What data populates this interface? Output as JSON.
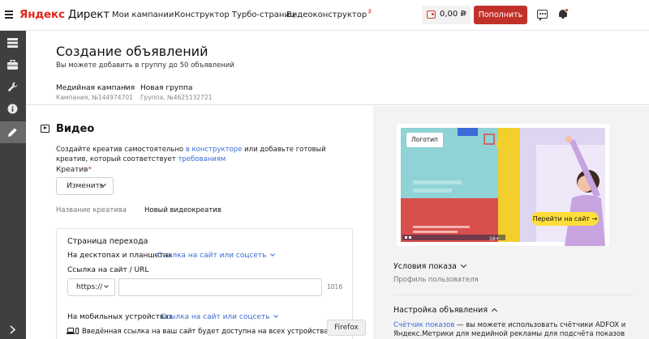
{
  "topbar": {
    "logo_brand": "Яндекс",
    "logo_product": "Директ",
    "nav": [
      "Мои кампании",
      "Конструктор Турбо-страниц",
      "Видеоконструктор"
    ],
    "nav_beta_mark": "β",
    "balance": "0,00 ₽",
    "balance_chevron": "∨",
    "topup_label": "Пополнить"
  },
  "page": {
    "title": "Создание объявлений",
    "subtitle": "Вы можете добавить в группу до 50 объявлений",
    "breadcrumb": {
      "campaign": "Медийная кампания",
      "campaign_id": "Кампания, №144974701",
      "separator": "›",
      "group": "Новая группа",
      "group_id": "Группа, №4625132721"
    }
  },
  "form": {
    "section_title": "Видео",
    "desc_1": "Создайте креатив самостоятельно ",
    "desc_link_1": "в конструкторе",
    "desc_2": " или добавьте готовый креатив, который соответствует ",
    "desc_link_2": "требованиям",
    "creative_label": "Креатив",
    "required_mark": "*",
    "change_button": "Изменить",
    "name_label": "Название креатива",
    "name_value": "Новый видеокреатив",
    "landing": {
      "title": "Страница перехода",
      "desktop_label": "На десктопах и планшетах",
      "desktop_link": "Ссылка на сайт или соцсеть",
      "url_label": "Ссылка на сайт / URL",
      "protocol": "https://",
      "url_value": "",
      "counter": "1016",
      "mobile_label": "На мобильных устройствах",
      "mobile_link": "Ссылка на сайт или соцсеть",
      "devices_note": "Введённая ссылка на ваш сайт будет доступна на всех устройствах"
    }
  },
  "tooltip": "Firefox",
  "preview": {
    "logo_text": "Логотип",
    "button_text": "Перейти на сайт →",
    "age_mark": "16+",
    "colors": {
      "teal": "#8fd3d6",
      "red": "#d94f4b",
      "lavender": "#ded5f3",
      "yellow": "#ffde3b"
    }
  },
  "right_panel": {
    "conditions_title": "Условия показа",
    "profile_label": "Профиль пользователя",
    "setup_title": "Настройка объявления",
    "setup_link": "Счётчик показов",
    "setup_text": " — вы можете использовать счётчики ADFOX и Яндекс.Метрики для медийной рекламы для подсчёта показов объявлений. В"
  }
}
